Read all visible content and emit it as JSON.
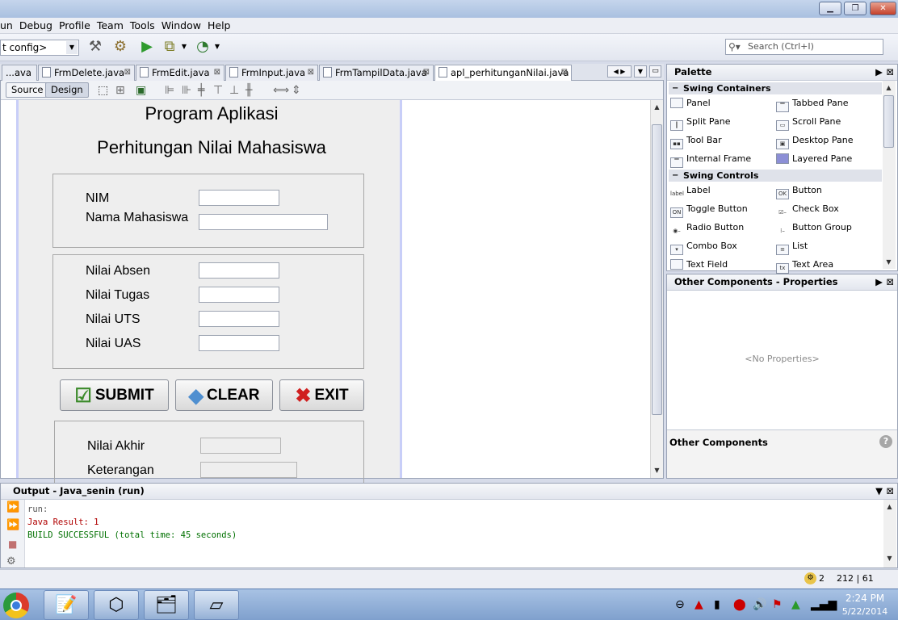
{
  "window": {
    "minimize": "▁",
    "restore": "❐",
    "close": "✕"
  },
  "menus": [
    "un",
    "Debug",
    "Profile",
    "Team",
    "Tools",
    "Window",
    "Help"
  ],
  "toolbar": {
    "config_value": "t config>",
    "search_placeholder": "Search (Ctrl+I)"
  },
  "tabs": [
    {
      "label": "...ava"
    },
    {
      "label": "FrmDelete.java"
    },
    {
      "label": "FrmEdit.java"
    },
    {
      "label": "FrmInput.java"
    },
    {
      "label": "FrmTampilData.java"
    },
    {
      "label": "apl_perhitunganNilai.java"
    }
  ],
  "editor_modes": {
    "source": "Source",
    "design": "Design"
  },
  "form": {
    "title1": "Program Aplikasi",
    "title2": "Perhitungan Nilai Mahasiswa",
    "nim_label": "NIM",
    "nama_label": "Nama Mahasiswa",
    "absen_label": "Nilai Absen",
    "tugas_label": "Nilai Tugas",
    "uts_label": "Nilai UTS",
    "uas_label": "Nilai UAS",
    "submit_label": "SUBMIT",
    "clear_label": "CLEAR",
    "exit_label": "EXIT",
    "akhir_label": "Nilai Akhir",
    "ket_label": "Keterangan"
  },
  "palette": {
    "title": "Palette",
    "cat_containers": "Swing Containers",
    "cat_controls": "Swing Controls",
    "containers": [
      "Panel",
      "Tabbed Pane",
      "Split Pane",
      "Scroll Pane",
      "Tool Bar",
      "Desktop Pane",
      "Internal Frame",
      "Layered Pane"
    ],
    "controls": [
      "Label",
      "Button",
      "Toggle Button",
      "Check Box",
      "Radio Button",
      "Button Group",
      "Combo Box",
      "List",
      "Text Field",
      "Text Area"
    ]
  },
  "properties": {
    "title": "Other Components - Properties",
    "empty": "<No Properties>",
    "section": "Other Components"
  },
  "output": {
    "title": "Output - Java_senin (run)",
    "line1": "run:",
    "line2": "Java Result: 1",
    "line3": "BUILD SUCCESSFUL (total time: 45 seconds)"
  },
  "status": {
    "notifications": "2",
    "position": "212 | 61"
  },
  "taskbar": {
    "time": "2:24 PM",
    "date": "5/22/2014"
  },
  "colors": {
    "error_text": "#b00000",
    "success_text": "#007000",
    "form_border": "#c8cef8"
  }
}
